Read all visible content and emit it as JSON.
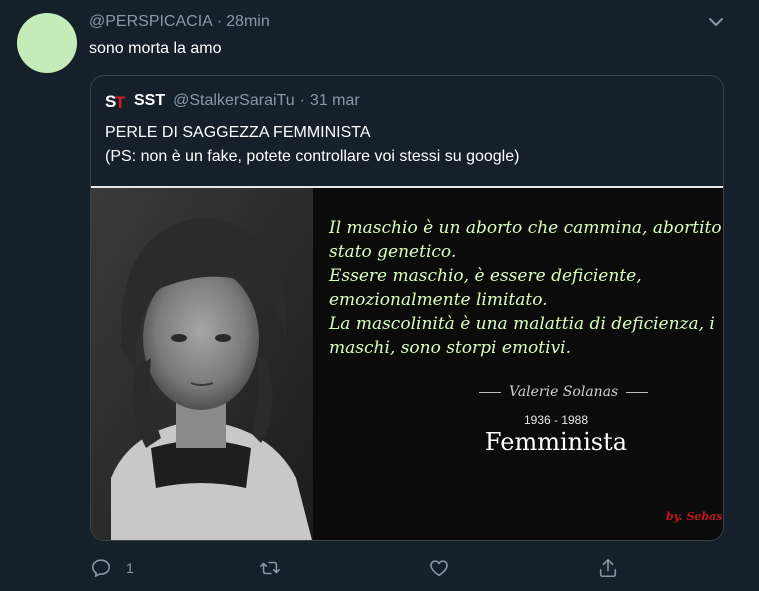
{
  "tweet": {
    "handle": "@PERSPICACIA",
    "separator": "·",
    "time": "28min",
    "text": "sono morta la amo",
    "avatar_color": "#c4ebb8"
  },
  "quoted": {
    "logo_text": "ST",
    "name": "SST",
    "handle": "@StalkerSaraiTu",
    "separator": "·",
    "date": "31 mar",
    "line1": "PERLE DI SAGGEZZA FEMMINISTA",
    "line2": "(PS: non è un fake, potete controllare voi stessi su google)"
  },
  "image": {
    "quote_lines": [
      "Il maschio è un aborto che cammina, abortito",
      "stato genetico.",
      "Essere maschio, è essere deficiente,",
      "emozionalmente limitato.",
      "La mascolinità è una malattia di deficienza, i",
      "maschi, sono storpi emotivi."
    ],
    "author": "Valerie Solanas",
    "years": "1936 - 1988",
    "title": "Femminista",
    "signature": "by. Sebasti"
  },
  "actions": {
    "reply_icon": "reply-icon",
    "reply_count": "1",
    "retweet_icon": "retweet-icon",
    "like_icon": "heart-icon",
    "share_icon": "share-icon"
  },
  "colors": {
    "background": "#15202b",
    "muted": "#8899a6",
    "border": "#38444d",
    "quote_text": "#d9ffbf"
  }
}
